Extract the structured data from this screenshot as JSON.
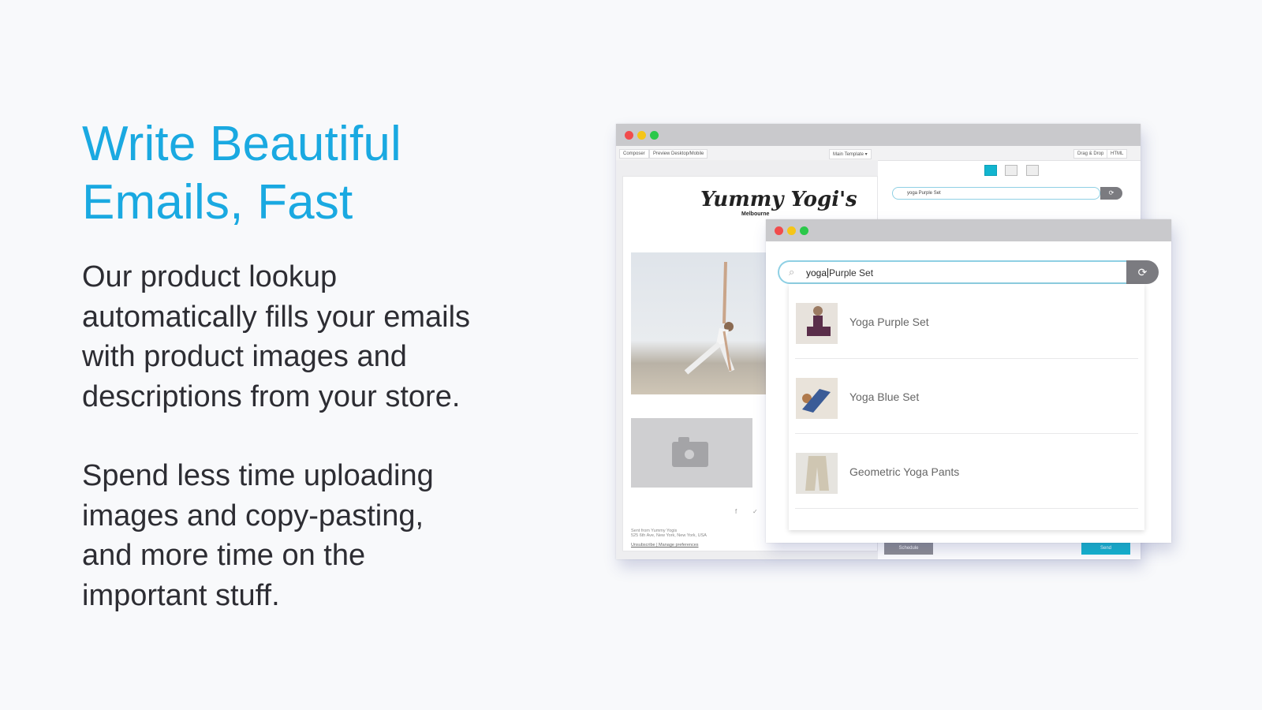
{
  "headline": [
    "Write Beautiful",
    "Emails, Fast"
  ],
  "paragraph1": [
    "Our product lookup",
    "automatically fills your emails",
    "with product images and",
    "descriptions from your store."
  ],
  "paragraph2": [
    "Spend less time uploading",
    "images and copy-pasting,",
    "and more time on the",
    "important stuff."
  ],
  "colors": {
    "accent": "#1aa9e1",
    "button_teal": "#12b5cf",
    "body_text": "#2d2d33"
  },
  "editor": {
    "tabs": [
      "Composer",
      "Preview Desktop/Mobile",
      "Main Template ▾",
      "Drag & Drop",
      "HTML"
    ],
    "brand_name": "Yummy Yogi's",
    "brand_location": "Melbourne",
    "mini_search_value": "yoga Purple Set",
    "footer_line1": "Sent from Yummy Yogis",
    "footer_line2": "525 6th Ave, New York, New York, USA",
    "footer_links": "Unsubscribe | Manage preferences",
    "social_icons": [
      "facebook-icon",
      "twitter-icon"
    ],
    "schedule_label": "Schedule",
    "send_label": "Send"
  },
  "lookup": {
    "typed": "yoga",
    "completion": "Purple Set",
    "results": [
      {
        "name": "Yoga Purple Set"
      },
      {
        "name": "Yoga Blue Set"
      },
      {
        "name": "Geometric Yoga Pants"
      }
    ]
  }
}
